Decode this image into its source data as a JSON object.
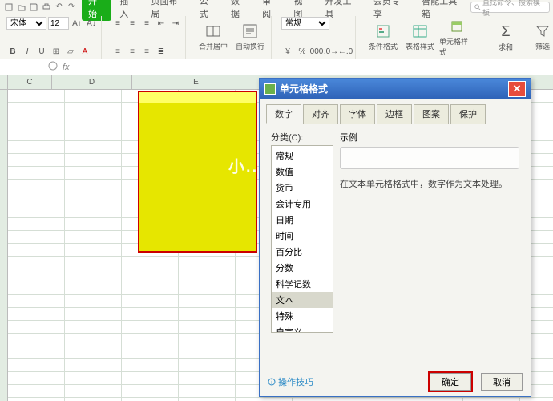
{
  "app": {
    "ribbon_tabs": [
      "开始",
      "插入",
      "页面布局",
      "公式",
      "数据",
      "审阅",
      "视图",
      "开发工具",
      "会员专享",
      "智能工具箱"
    ],
    "active_tab": "开始",
    "search_placeholder": "直找命令、搜索模板",
    "font_size": "12",
    "btn_merge": "合并居中",
    "btn_wrap": "自动换行",
    "num_format_group": "常规",
    "btn_cond": "条件格式",
    "btn_table_style": "表格样式",
    "btn_cell_style": "单元格样式",
    "btn_sum": "求和",
    "btn_filter": "筛选",
    "currency_symbol": "¥",
    "pct": "%",
    "fx": "fx",
    "namebox": "",
    "columns": [
      "C",
      "D",
      "E"
    ]
  },
  "watermark": "小...",
  "dialog": {
    "title": "单元格格式",
    "tabs": [
      "数字",
      "对齐",
      "字体",
      "边框",
      "图案",
      "保护"
    ],
    "category_label": "分类(C):",
    "categories": [
      "常规",
      "数值",
      "货币",
      "会计专用",
      "日期",
      "时间",
      "百分比",
      "分数",
      "科学记数",
      "文本",
      "特殊",
      "自定义"
    ],
    "selected_category": "文本",
    "sample_label": "示例",
    "desc": "在文本单元格格式中，数字作为文本处理。",
    "tip": "操作技巧",
    "ok": "确定",
    "cancel": "取消"
  }
}
